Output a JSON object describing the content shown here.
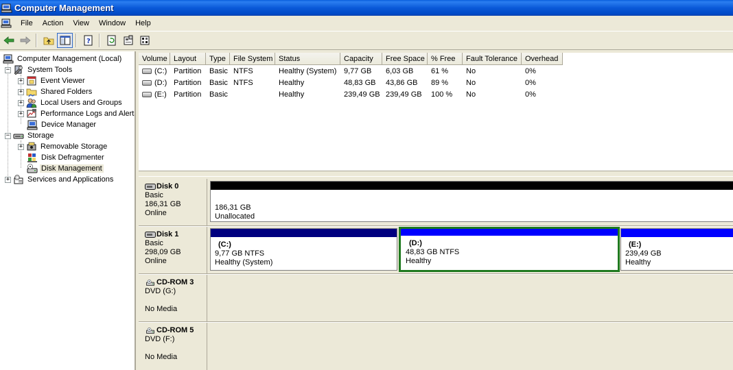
{
  "window": {
    "title": "Computer Management"
  },
  "menu": {
    "items": [
      "File",
      "Action",
      "View",
      "Window",
      "Help"
    ]
  },
  "toolbar": {
    "buttons": [
      "back-arrow-icon",
      "forward-arrow-icon",
      "up-folder-icon",
      "show-hide-tree-icon",
      "help-icon",
      "refresh-icon",
      "properties-icon",
      "settings-icon"
    ]
  },
  "tree": {
    "root": "Computer Management (Local)",
    "system_tools": "System Tools",
    "event_viewer": "Event Viewer",
    "shared_folders": "Shared Folders",
    "local_users": "Local Users and Groups",
    "perf_logs": "Performance Logs and Alerts",
    "device_manager": "Device Manager",
    "storage": "Storage",
    "removable_storage": "Removable Storage",
    "disk_defrag": "Disk Defragmenter",
    "disk_management": "Disk Management",
    "services": "Services and Applications",
    "expand_plus": "+",
    "expand_minus": "−"
  },
  "volumes": {
    "columns": [
      "Volume",
      "Layout",
      "Type",
      "File System",
      "Status",
      "Capacity",
      "Free Space",
      "% Free",
      "Fault Tolerance",
      "Overhead"
    ],
    "rows": [
      [
        "(C:)",
        "Partition",
        "Basic",
        "NTFS",
        "Healthy (System)",
        "9,77 GB",
        "6,03 GB",
        "61 %",
        "No",
        "0%"
      ],
      [
        "(D:)",
        "Partition",
        "Basic",
        "NTFS",
        "Healthy",
        "48,83 GB",
        "43,86 GB",
        "89 %",
        "No",
        "0%"
      ],
      [
        "(E:)",
        "Partition",
        "Basic",
        "",
        "Healthy",
        "239,49 GB",
        "239,49 GB",
        "100 %",
        "No",
        "0%"
      ]
    ]
  },
  "disks": {
    "disk0": {
      "name": "Disk 0",
      "type": "Basic",
      "size": "186,31 GB",
      "status": "Online",
      "part_size": "186,31 GB",
      "part_status": "Unallocated"
    },
    "disk1": {
      "name": "Disk 1",
      "type": "Basic",
      "size": "298,09 GB",
      "status": "Online",
      "c": {
        "name": "(C:)",
        "info": "9,77 GB NTFS",
        "status": "Healthy (System)"
      },
      "d": {
        "name": "(D:)",
        "info": "48,83 GB NTFS",
        "status": "Healthy"
      },
      "e": {
        "name": "(E:)",
        "info": "239,49 GB",
        "status": "Healthy"
      }
    },
    "cdrom3": {
      "name": "CD-ROM 3",
      "drive": "DVD (G:)",
      "status": "No Media"
    },
    "cdrom5": {
      "name": "CD-ROM 5",
      "drive": "DVD (F:)",
      "status": "No Media"
    }
  },
  "colors": {
    "titlebar": "#0a59d8",
    "unallocated_bar": "#000000",
    "primary_system_bar": "#00007f",
    "primary_bar": "#0000ff",
    "selected_partition_border": "#1f7a1f"
  }
}
